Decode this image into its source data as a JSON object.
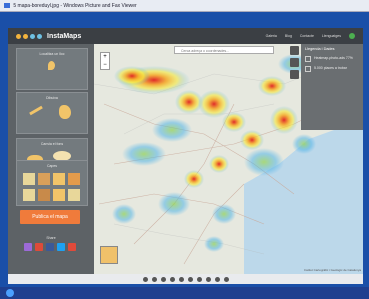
{
  "window": {
    "title": "5 mapa-boreduyl.jpg - Windows Picture and Fax Viewer"
  },
  "app": {
    "brand": "InstaMaps",
    "nav": [
      "Galeria",
      "Blog",
      "Contacte",
      "Llenguatges"
    ]
  },
  "sidebar": {
    "section1_label": "Localitza un lloc",
    "section2_label": "Dibuixa",
    "section3_label": "Canvia el fons",
    "section4_label": "Capes",
    "publish_label": "Publica el mapa",
    "share_label": "Share"
  },
  "map": {
    "search_placeholder": "Cerca adreça o coordenades...",
    "zoom_in": "+",
    "zoom_out": "−",
    "layers": {
      "header": "Llegenda i Dades",
      "items": [
        "Heatmap-photo-ads 77%",
        "5.000 places a trobar"
      ]
    },
    "attribution": "Institut Cartogràfic i Geològic de Catalunya"
  },
  "colors": {
    "accent": "#f07b3b",
    "header": "#3b3f44",
    "sidebar": "#5d6266",
    "frame": "#1a4fa8",
    "border": "#f5c518"
  }
}
